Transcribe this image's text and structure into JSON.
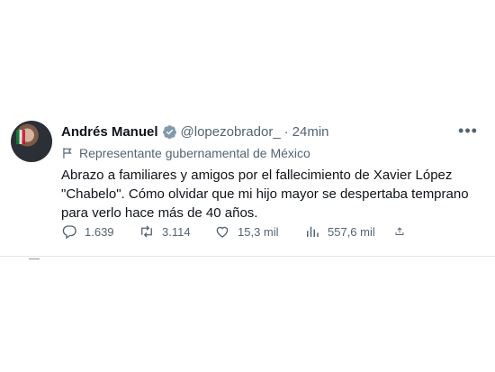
{
  "tweet": {
    "author_name": "Andrés Manuel",
    "handle": "@lopezobrador_",
    "separator": "·",
    "time": "24min",
    "label": "Representante gubernamental de México",
    "text": "Abrazo a familiares y amigos por el fallecimiento de Xavier López \"Chabelo\". Cómo olvidar que mi hijo mayor se despertaba temprano para verlo hace más de 40 años.",
    "more_icon": "ellipsis-icon",
    "stats": {
      "replies": "1.639",
      "retweets": "3.114",
      "likes": "15,3 mil",
      "views": "557,6 mil"
    }
  },
  "colors": {
    "text": "#0f1419",
    "muted": "#536471",
    "verified_badge": "#829aab",
    "border": "#e1e6ea"
  }
}
